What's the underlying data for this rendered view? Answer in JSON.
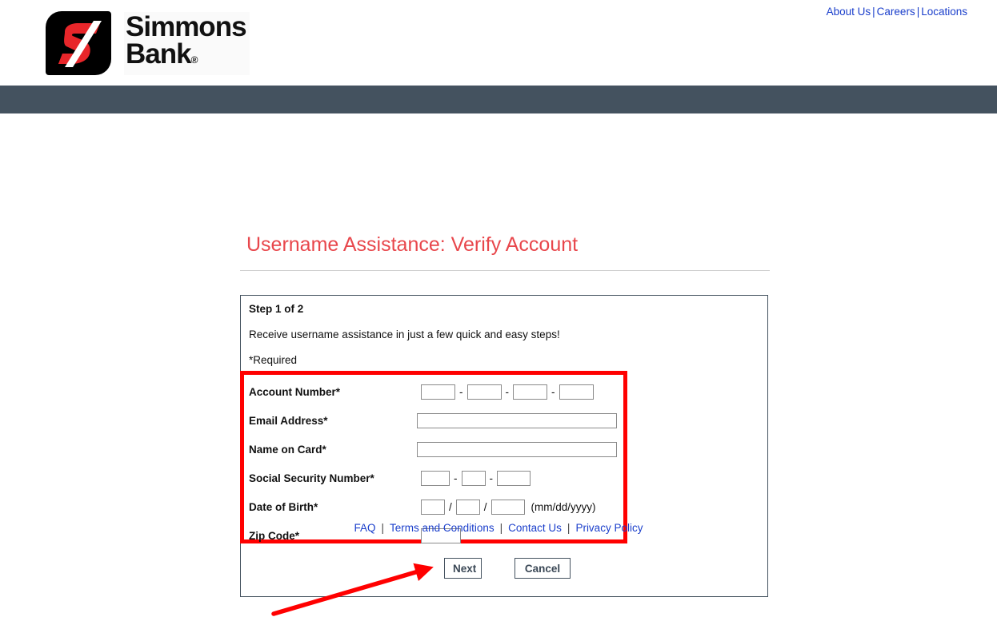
{
  "header": {
    "logo_alt": "Simmons Bank",
    "wordmark_line1": "Simmons",
    "wordmark_line2": "Bank",
    "wordmark_reg": "®",
    "top_links": [
      {
        "label": "About Us"
      },
      {
        "label": "Careers"
      },
      {
        "label": "Locations"
      }
    ],
    "top_link_separator": "|",
    "navbar_color": "#44525f"
  },
  "page": {
    "title": "Username Assistance: Verify Account",
    "title_color": "#e8474c"
  },
  "form": {
    "step_label": "Step 1 of 2",
    "intro_text": "Receive username assistance in just a few quick and easy steps!",
    "required_note": "*Required",
    "highlight_color": "#ff0000",
    "fields": [
      {
        "label": "Account Number*",
        "inputs": [
          {
            "name": "account-number-part-1",
            "value": "",
            "placeholder": ""
          },
          {
            "name": "account-number-part-2",
            "value": "",
            "placeholder": ""
          },
          {
            "name": "account-number-part-3",
            "value": "",
            "placeholder": ""
          },
          {
            "name": "account-number-part-4",
            "value": "",
            "placeholder": ""
          }
        ],
        "separator": "-"
      },
      {
        "label": "Email Address*",
        "inputs": [
          {
            "name": "email-address",
            "value": "",
            "placeholder": ""
          }
        ]
      },
      {
        "label": "Name on Card*",
        "inputs": [
          {
            "name": "name-on-card",
            "value": "",
            "placeholder": ""
          }
        ]
      },
      {
        "label": "Social Security Number*",
        "inputs": [
          {
            "name": "ssn-part-1",
            "value": "",
            "placeholder": ""
          },
          {
            "name": "ssn-part-2",
            "value": "",
            "placeholder": ""
          },
          {
            "name": "ssn-part-3",
            "value": "",
            "placeholder": ""
          }
        ],
        "separator": "-"
      },
      {
        "label": "Date of Birth*",
        "inputs": [
          {
            "name": "dob-month",
            "value": "",
            "placeholder": ""
          },
          {
            "name": "dob-day",
            "value": "",
            "placeholder": ""
          },
          {
            "name": "dob-year",
            "value": "",
            "placeholder": ""
          }
        ],
        "separator": "/",
        "hint": "(mm/dd/yyyy)"
      },
      {
        "label": "Zip Code*",
        "inputs": [
          {
            "name": "zip-code",
            "value": "",
            "placeholder": ""
          }
        ]
      }
    ],
    "next_label": "Next",
    "cancel_label": "Cancel"
  },
  "annotation": {
    "type": "arrow",
    "color": "#ff0000",
    "points_to": "Next"
  },
  "footer": {
    "links": [
      {
        "label": "FAQ"
      },
      {
        "label": "Terms and Conditions"
      },
      {
        "label": "Contact Us"
      },
      {
        "label": "Privacy Policy"
      }
    ],
    "separator": "|"
  }
}
